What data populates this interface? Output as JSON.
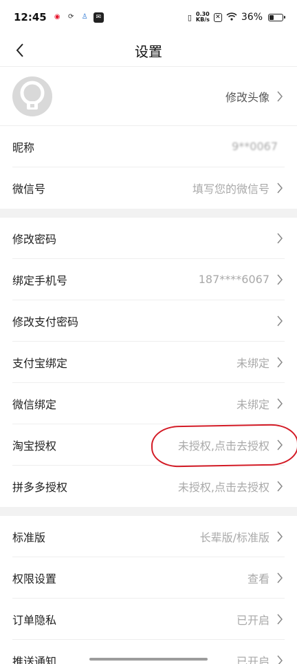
{
  "status_bar": {
    "time": "12:45",
    "net_speed_top": "0.30",
    "net_speed_bottom": "KB/s",
    "battery_level": 0.36,
    "battery_text": "36%"
  },
  "nav": {
    "title": "设置"
  },
  "avatar_section": {
    "action_label": "修改头像"
  },
  "profile_rows": [
    {
      "label": "昵称",
      "value": "9**0067"
    },
    {
      "label": "微信号",
      "value": "填写您的微信号"
    }
  ],
  "account_rows": [
    {
      "label": "修改密码",
      "value": ""
    },
    {
      "label": "绑定手机号",
      "value": "187****6067"
    },
    {
      "label": "修改支付密码",
      "value": ""
    },
    {
      "label": "支付宝绑定",
      "value": "未绑定"
    },
    {
      "label": "微信绑定",
      "value": "未绑定"
    },
    {
      "label": "淘宝授权",
      "value": "未授权,点击去授权"
    },
    {
      "label": "拼多多授权",
      "value": "未授权,点击去授权"
    }
  ],
  "other_rows": [
    {
      "label": "标准版",
      "value": "长辈版/标准版"
    },
    {
      "label": "权限设置",
      "value": "查看"
    },
    {
      "label": "订单隐私",
      "value": "已开启"
    },
    {
      "label": "推送通知",
      "value": "已开启"
    }
  ],
  "colors": {
    "annotation_red": "#d31a25",
    "section_gap": "#f2f2f2",
    "value_gray": "#a9a9a9"
  }
}
